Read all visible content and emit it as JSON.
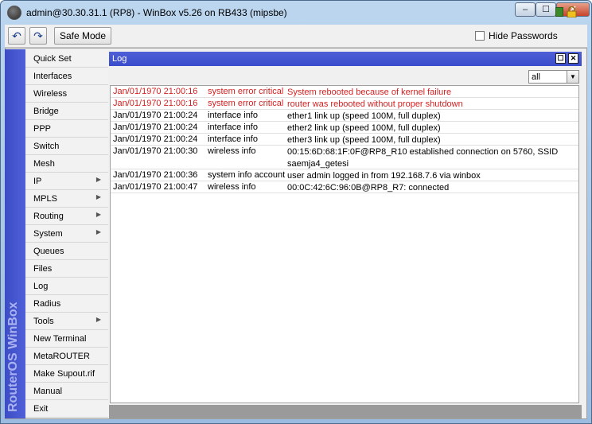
{
  "window": {
    "title": "admin@30.30.31.1 (RP8) - WinBox v5.26 on RB433 (mipsbe)",
    "minimize_label": "–",
    "maximize_label": "☐",
    "close_label": "✕"
  },
  "toolbar": {
    "undo_icon": "↶",
    "redo_icon": "↷",
    "safe_mode_label": "Safe Mode",
    "hide_passwords_label": "Hide Passwords",
    "hide_passwords_checked": false
  },
  "brand": {
    "text": "RouterOS WinBox"
  },
  "menu": {
    "items": [
      {
        "label": "Quick Set",
        "submenu": false
      },
      {
        "label": "Interfaces",
        "submenu": false
      },
      {
        "label": "Wireless",
        "submenu": false
      },
      {
        "label": "Bridge",
        "submenu": false
      },
      {
        "label": "PPP",
        "submenu": false
      },
      {
        "label": "Switch",
        "submenu": false
      },
      {
        "label": "Mesh",
        "submenu": false
      },
      {
        "label": "IP",
        "submenu": true
      },
      {
        "label": "MPLS",
        "submenu": true
      },
      {
        "label": "Routing",
        "submenu": true
      },
      {
        "label": "System",
        "submenu": true
      },
      {
        "label": "Queues",
        "submenu": false
      },
      {
        "label": "Files",
        "submenu": false
      },
      {
        "label": "Log",
        "submenu": false
      },
      {
        "label": "Radius",
        "submenu": false
      },
      {
        "label": "Tools",
        "submenu": true
      },
      {
        "label": "New Terminal",
        "submenu": false
      },
      {
        "label": "MetaROUTER",
        "submenu": false
      },
      {
        "label": "Make Supout.rif",
        "submenu": false
      },
      {
        "label": "Manual",
        "submenu": false
      },
      {
        "label": "Exit",
        "submenu": false
      }
    ],
    "submenu_arrow": "▶"
  },
  "log": {
    "title": "Log",
    "restore_label": "☐",
    "close_label": "✕",
    "filter_value": "all",
    "filter_arrow": "▼",
    "entries": [
      {
        "time": "Jan/01/1970 21:00:16",
        "topics": "system error critical",
        "message": "System rebooted because of kernel failure",
        "level": "error"
      },
      {
        "time": "Jan/01/1970 21:00:16",
        "topics": "system error critical",
        "message": "router was rebooted without proper shutdown",
        "level": "error"
      },
      {
        "time": "Jan/01/1970 21:00:24",
        "topics": "interface info",
        "message": "ether1 link up (speed 100M, full duplex)",
        "level": "info"
      },
      {
        "time": "Jan/01/1970 21:00:24",
        "topics": "interface info",
        "message": "ether2 link up (speed 100M, full duplex)",
        "level": "info"
      },
      {
        "time": "Jan/01/1970 21:00:24",
        "topics": "interface info",
        "message": "ether3 link up (speed 100M, full duplex)",
        "level": "info"
      },
      {
        "time": "Jan/01/1970 21:00:30",
        "topics": "wireless info",
        "message": "00:15:6D:68:1F:0F@RP8_R10 established connection on 5760, SSID saemja4_getesi",
        "level": "info"
      },
      {
        "time": "Jan/01/1970 21:00:36",
        "topics": "system info account",
        "message": "user admin logged in from 192.168.7.6 via winbox",
        "level": "info"
      },
      {
        "time": "Jan/01/1970 21:00:47",
        "topics": "wireless info",
        "message": "00:0C:42:6C:96:0B@RP8_R7: connected",
        "level": "info"
      }
    ]
  },
  "colors": {
    "brand_blue": "#4352d0",
    "error_red": "#d42020",
    "lock_color": "#f0c020"
  }
}
